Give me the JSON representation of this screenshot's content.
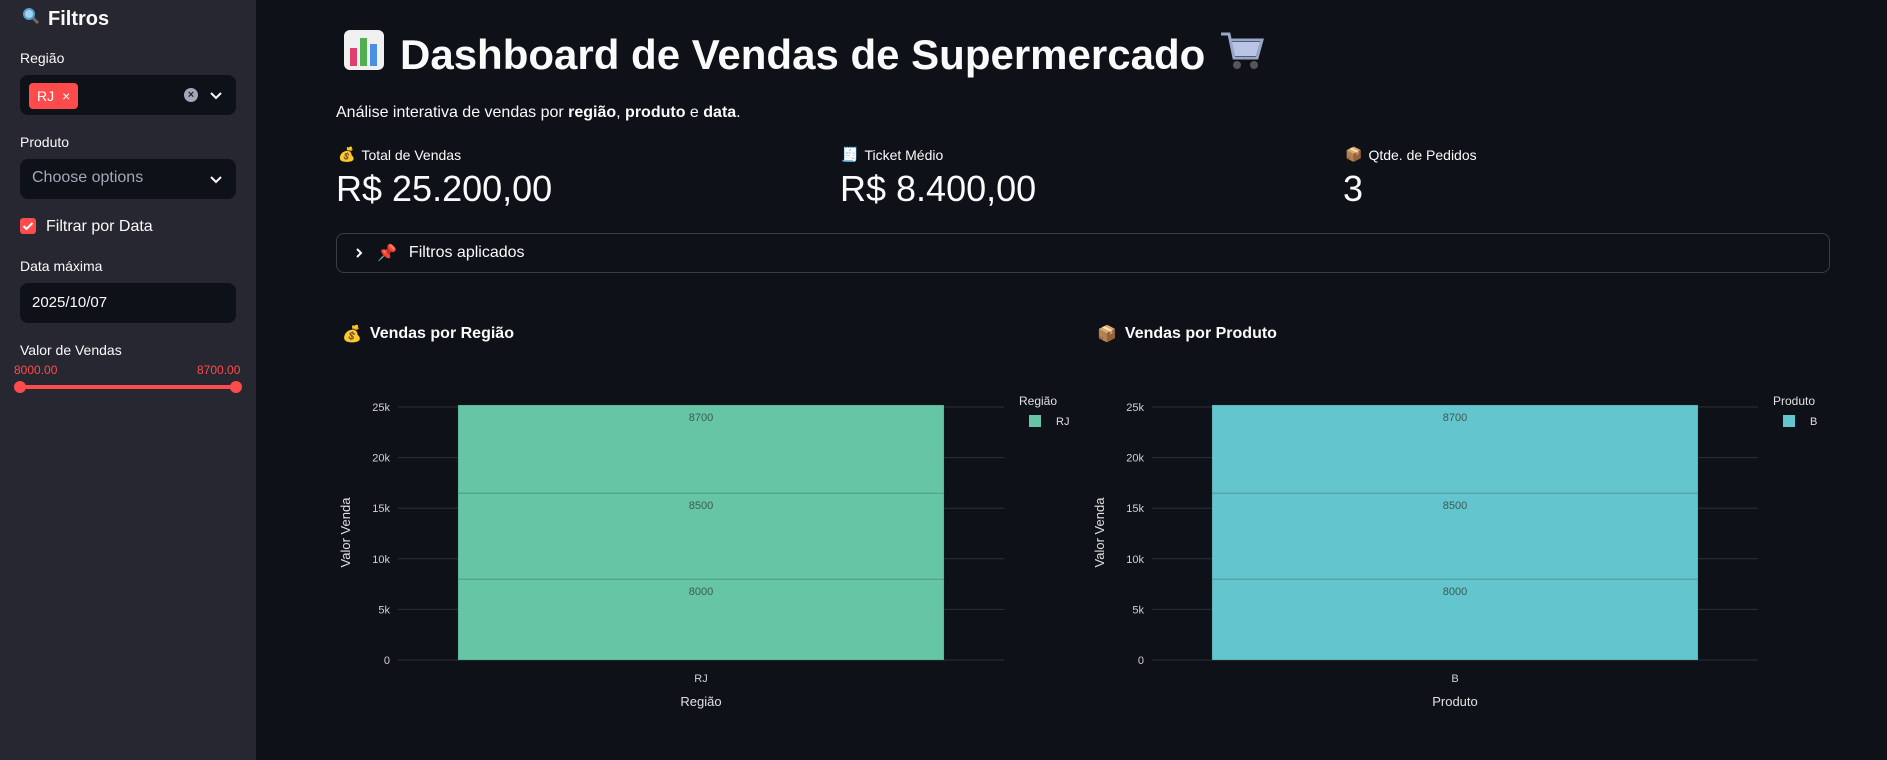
{
  "sidebar": {
    "title": "Filtros",
    "regiao_label": "Região",
    "regiao_tag": "RJ",
    "produto_label": "Produto",
    "produto_placeholder": "Choose options",
    "filtrar_data_label": "Filtrar por Data",
    "data_maxima_label": "Data máxima",
    "data_maxima_value": "2025/10/07",
    "valor_vendas_label": "Valor de Vendas",
    "slider_min": "8000.00",
    "slider_max": "8700.00"
  },
  "header": {
    "title": "Dashboard de Vendas de Supermercado",
    "subtitle_prefix": "Análise interativa de vendas por ",
    "subtitle_b1": "região",
    "subtitle_sep1": ", ",
    "subtitle_b2": "produto",
    "subtitle_sep2": " e ",
    "subtitle_b3": "data",
    "subtitle_end": "."
  },
  "metrics": [
    {
      "label": "Total de Vendas",
      "value": "R$ 25.200,00",
      "icon": "money-bag-icon"
    },
    {
      "label": "Ticket Médio",
      "value": "R$ 8.400,00",
      "icon": "receipt-icon"
    },
    {
      "label": "Qtde. de Pedidos",
      "value": "3",
      "icon": "package-icon"
    }
  ],
  "expander": {
    "label": "Filtros aplicados"
  },
  "charts": {
    "regiao_title": "Vendas por Região",
    "produto_title": "Vendas por Produto"
  },
  "chart_data": [
    {
      "type": "bar",
      "title": "Vendas por Região",
      "xlabel": "Região",
      "ylabel": "Valor Venda",
      "categories": [
        "RJ"
      ],
      "stack_segments": [
        8000,
        8500,
        8700
      ],
      "ylim": [
        0,
        25200
      ],
      "yticks": [
        "0",
        "5k",
        "10k",
        "15k",
        "20k",
        "25k"
      ],
      "legend_title": "Região",
      "legend": [
        "RJ"
      ],
      "color": "#66c5a5"
    },
    {
      "type": "bar",
      "title": "Vendas por Produto",
      "xlabel": "Produto",
      "ylabel": "Valor Venda",
      "categories": [
        "B"
      ],
      "stack_segments": [
        8000,
        8500,
        8700
      ],
      "ylim": [
        0,
        25200
      ],
      "yticks": [
        "0",
        "5k",
        "10k",
        "15k",
        "20k",
        "25k"
      ],
      "legend_title": "Produto",
      "legend": [
        "B"
      ],
      "color": "#63c5cd"
    }
  ]
}
